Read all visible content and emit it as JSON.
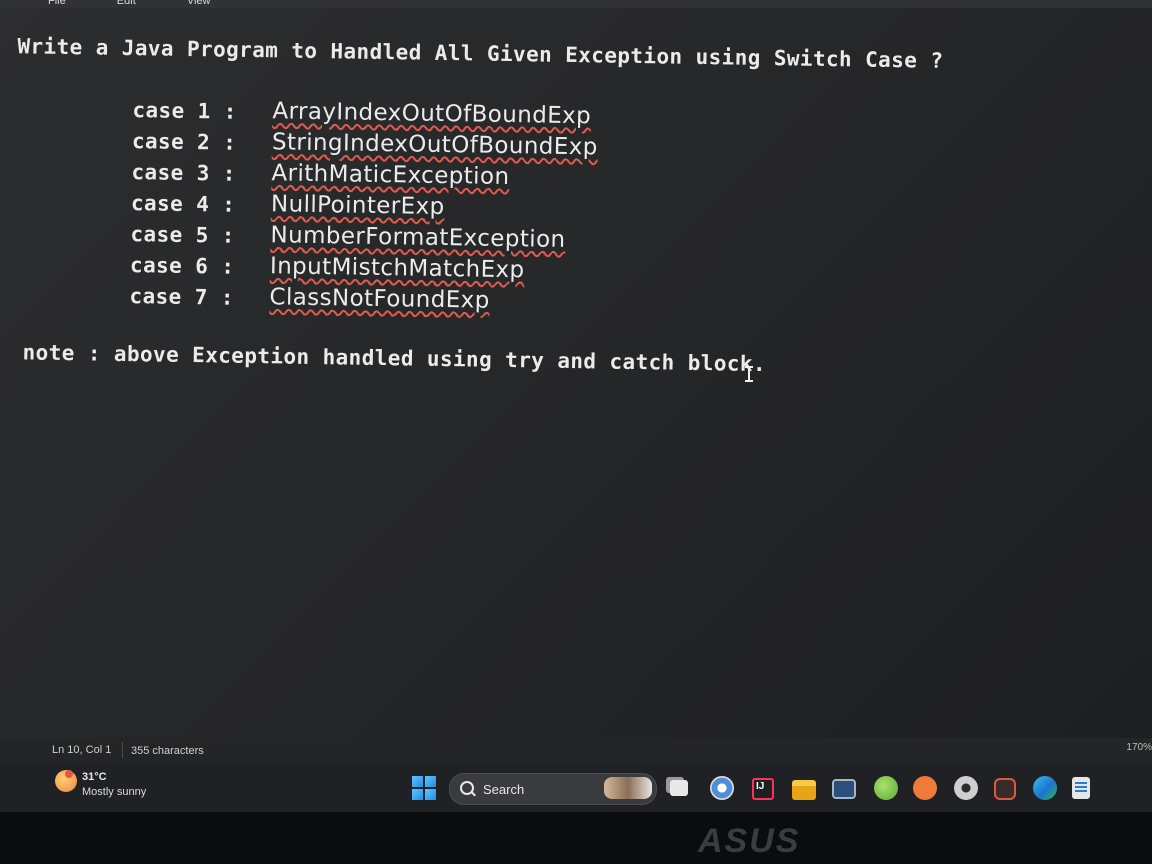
{
  "menubar": {
    "items": [
      "File",
      "Edit",
      "View"
    ]
  },
  "editor": {
    "title": "Write a Java Program to Handled All Given Exception using Switch Case ?",
    "cases": [
      {
        "label": "case 1 :",
        "value": "ArrayIndexOutOfBoundExp"
      },
      {
        "label": "case 2 :",
        "value": "StringIndexOutOfBoundExp"
      },
      {
        "label": "case 3 :",
        "value": "ArithMaticException"
      },
      {
        "label": "case 4 :",
        "value": "NullPointerExp"
      },
      {
        "label": "case 5 :",
        "value": "NumberFormatException"
      },
      {
        "label": "case 6 :",
        "value": "InputMistchMatchExp"
      },
      {
        "label": "case 7 :",
        "value": "ClassNotFoundExp"
      }
    ],
    "note": "note : above Exception handled using try and catch block."
  },
  "statusbar": {
    "position": "Ln 10, Col 1",
    "characters": "355 characters",
    "right": "170%"
  },
  "taskbar": {
    "weather": {
      "temp": "31°C",
      "condition": "Mostly sunny"
    },
    "search_label": "Search",
    "icons": [
      "windows-start-icon",
      "copilot-icon",
      "browser-icon",
      "intellij-icon",
      "file-explorer-icon",
      "monitor-app-icon",
      "spring-icon",
      "postman-icon",
      "settings-gear-icon",
      "recorder-icon",
      "edge-icon",
      "notepad-icon"
    ]
  },
  "bezel": {
    "brand": "ASUS"
  }
}
